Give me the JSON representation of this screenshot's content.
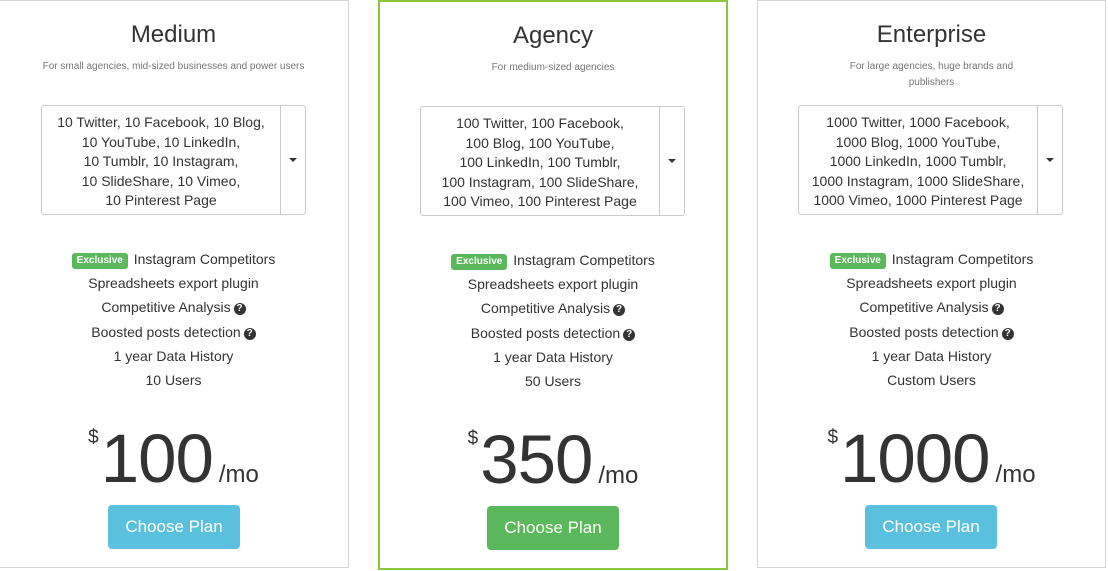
{
  "plans": [
    {
      "title": "Medium",
      "subtitle": "For small agencies, mid-sized businesses and power users",
      "profiles_select": [
        "10 Twitter, 10 Facebook, 10 Blog,",
        "10 YouTube, 10 LinkedIn,",
        "10 Tumblr, 10 Instagram,",
        "10 SlideShare, 10 Vimeo,",
        "10 Pinterest Page"
      ],
      "features": {
        "badge": "Exclusive",
        "f0": "Instagram Competitors",
        "f1": "Spreadsheets export plugin",
        "f2": "Competitive Analysis",
        "f3": "Boosted posts detection",
        "f4": "1 year Data History",
        "f5": "10 Users"
      },
      "currency": "$",
      "price": "100",
      "period": "/mo",
      "button_label": "Choose Plan",
      "button_color": "#5bc0de",
      "featured": false
    },
    {
      "title": "Agency",
      "subtitle": "For medium-sized agencies",
      "profiles_select": [
        "100 Twitter, 100 Facebook,",
        "100 Blog, 100 YouTube,",
        "100 LinkedIn, 100 Tumblr,",
        "100 Instagram, 100 SlideShare,",
        "100 Vimeo, 100 Pinterest Page"
      ],
      "features": {
        "badge": "Exclusive",
        "f0": "Instagram Competitors",
        "f1": "Spreadsheets export plugin",
        "f2": "Competitive Analysis",
        "f3": "Boosted posts detection",
        "f4": "1 year Data History",
        "f5": "50 Users"
      },
      "currency": "$",
      "price": "350",
      "period": "/mo",
      "button_label": "Choose Plan",
      "button_color": "#5cb85c",
      "featured": true
    },
    {
      "title": "Enterprise",
      "subtitle": "For large agencies, huge brands and publishers",
      "profiles_select": [
        "1000 Twitter, 1000 Facebook,",
        "1000 Blog, 1000 YouTube,",
        "1000 LinkedIn, 1000 Tumblr,",
        "1000 Instagram, 1000 SlideShare,",
        "1000 Vimeo, 1000 Pinterest Page"
      ],
      "features": {
        "badge": "Exclusive",
        "f0": "Instagram Competitors",
        "f1": "Spreadsheets export plugin",
        "f2": "Competitive Analysis",
        "f3": "Boosted posts detection",
        "f4": "1 year Data History",
        "f5": "Custom Users"
      },
      "currency": "$",
      "price": "1000",
      "period": "/mo",
      "button_label": "Choose Plan",
      "button_color": "#5bc0de",
      "featured": false
    }
  ],
  "colors": {
    "featured_border": "#8cc63f",
    "badge": "#5cb85c",
    "info_button": "#5bc0de",
    "success_button": "#5cb85c"
  },
  "icons": {
    "help": "?"
  }
}
